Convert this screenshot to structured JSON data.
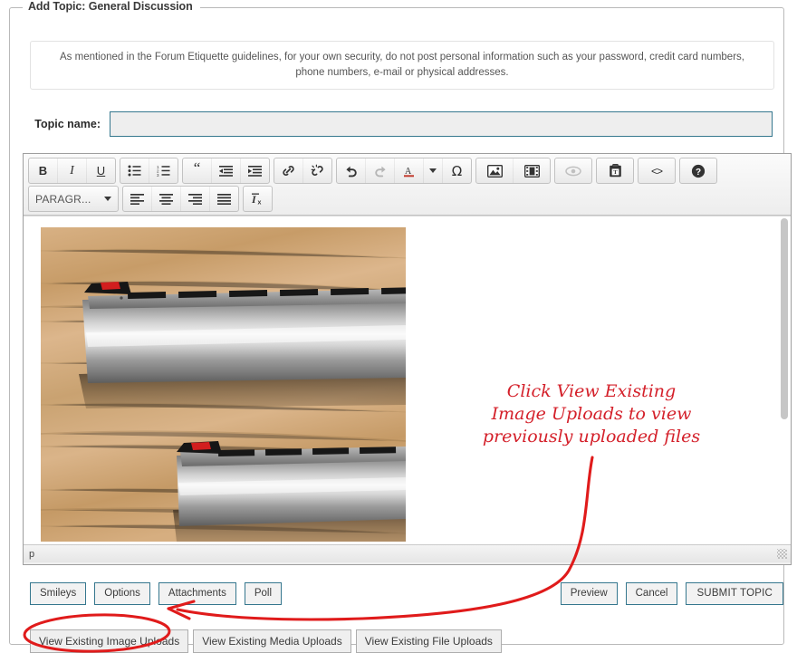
{
  "form": {
    "legend": "Add Topic: General Discussion",
    "notice": "As mentioned in the Forum Etiquette guidelines, for your own security, do not post personal information such as your password, credit card numbers, phone numbers, e-mail or physical addresses.",
    "topic_label": "Topic name:",
    "topic_value": "",
    "topic_placeholder": ""
  },
  "editor": {
    "toolbar_row1": [
      {
        "name": "bold-icon",
        "label": "B"
      },
      {
        "name": "italic-icon",
        "label": "I"
      },
      {
        "name": "underline-icon",
        "label": "U"
      },
      {
        "name": "bullet-list-icon",
        "label": ""
      },
      {
        "name": "numbered-list-icon",
        "label": ""
      },
      {
        "name": "blockquote-icon",
        "label": "“"
      },
      {
        "name": "outdent-icon",
        "label": ""
      },
      {
        "name": "indent-icon",
        "label": ""
      },
      {
        "name": "insert-link-icon",
        "label": ""
      },
      {
        "name": "unlink-icon",
        "label": ""
      },
      {
        "name": "undo-icon",
        "label": ""
      },
      {
        "name": "redo-icon",
        "label": ""
      },
      {
        "name": "text-color-icon",
        "label": "A"
      },
      {
        "name": "text-color-dropdown-icon",
        "label": ""
      },
      {
        "name": "special-character-icon",
        "label": "Ω"
      },
      {
        "name": "insert-image-icon",
        "label": ""
      },
      {
        "name": "insert-media-icon",
        "label": ""
      },
      {
        "name": "preview-eye-icon",
        "label": ""
      },
      {
        "name": "paste-as-text-icon",
        "label": ""
      },
      {
        "name": "source-code-icon",
        "label": "<>"
      },
      {
        "name": "help-icon",
        "label": "?"
      }
    ],
    "format_select": "PARAGR...",
    "toolbar_row2": [
      {
        "name": "align-left-icon",
        "label": ""
      },
      {
        "name": "align-center-icon",
        "label": ""
      },
      {
        "name": "align-right-icon",
        "label": ""
      },
      {
        "name": "align-justify-icon",
        "label": ""
      },
      {
        "name": "remove-format-icon",
        "label": "I"
      }
    ],
    "status_path": "p",
    "content_image_alt": "Two shotgun barrels with red fiber-optic front sights on a wooden table"
  },
  "buttons": {
    "smileys": "Smileys",
    "options": "Options",
    "attachments": "Attachments",
    "poll": "Poll",
    "preview": "Preview",
    "cancel": "Cancel",
    "submit": "SUBMIT TOPIC"
  },
  "uploads": {
    "image": "View Existing Image Uploads",
    "media": "View Existing Media Uploads",
    "file": "View Existing File Uploads"
  },
  "annotation": {
    "text_line1": "Click View Existing",
    "text_line2": "Image Uploads to view",
    "text_line3": "previously uploaded files",
    "color": "#d4202a"
  },
  "colors": {
    "accent_border": "#35778e",
    "frame_border": "#b9b9b9",
    "annotation_red": "#d4202a"
  }
}
